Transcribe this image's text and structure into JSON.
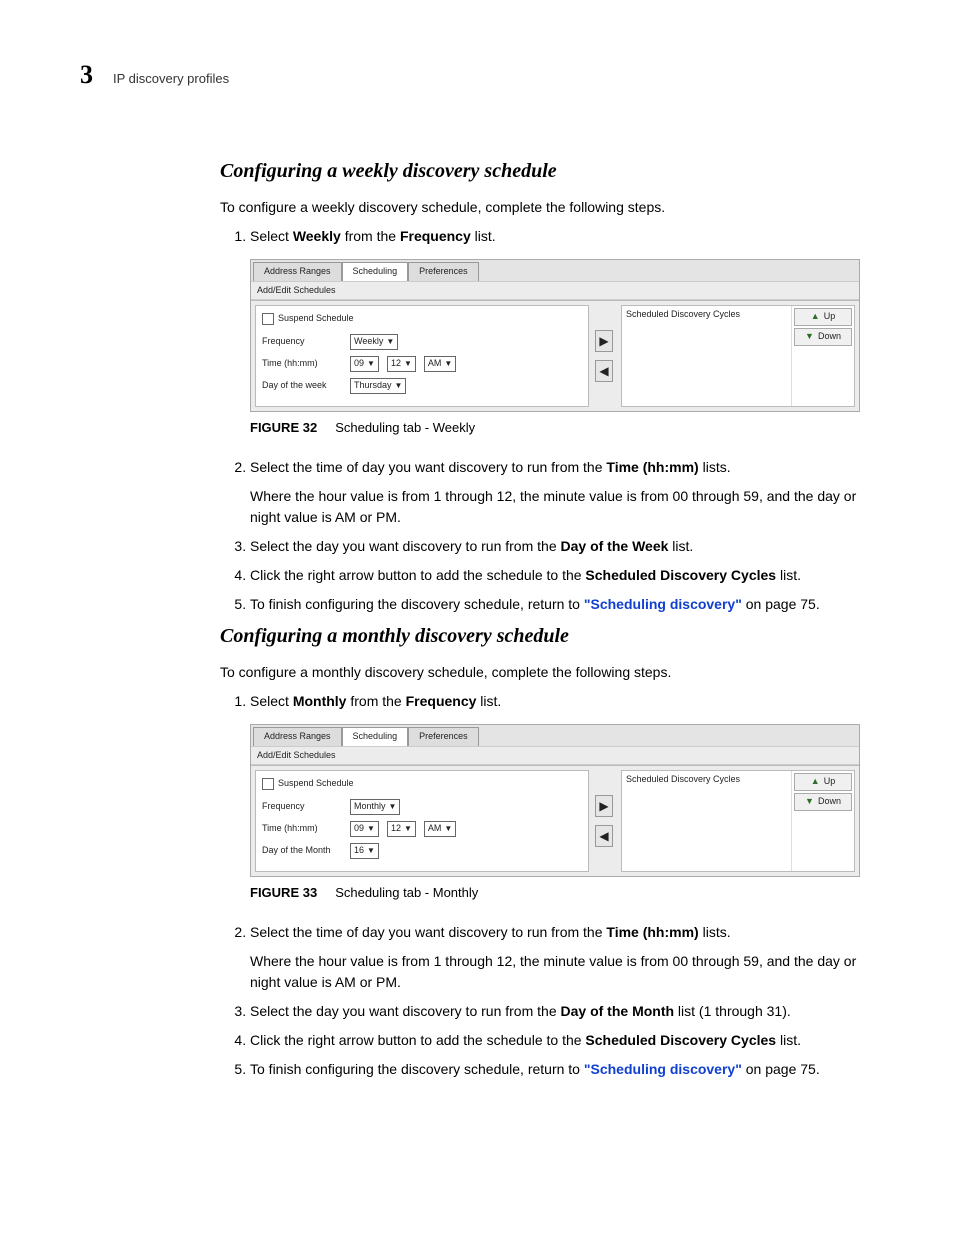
{
  "header": {
    "chapter": "3",
    "section": "IP discovery profiles"
  },
  "h_weekly": "Configuring a weekly discovery schedule",
  "p_weekly_intro": "To configure a weekly discovery schedule, complete the following steps.",
  "weekly": {
    "s1_a": "Select ",
    "s1_b": "Weekly",
    "s1_c": " from the ",
    "s1_d": "Frequency",
    "s1_e": " list.",
    "s2_a": "Select the time of day you want discovery to run from the ",
    "s2_b": "Time (hh:mm)",
    "s2_c": " lists.",
    "s2_sub": "Where the hour value is from 1 through 12, the minute value is from 00 through 59, and the day or night value is AM or PM.",
    "s3_a": "Select the day you want discovery to run from the ",
    "s3_b": "Day of the Week",
    "s3_c": " list.",
    "s4_a": "Click the right arrow button to add the schedule to the ",
    "s4_b": "Scheduled Discovery Cycles",
    "s4_c": " list.",
    "s5_a": "To finish configuring the discovery schedule, return to ",
    "s5_link": "\"Scheduling discovery\"",
    "s5_b": " on page 75."
  },
  "fig32": {
    "label": "FIGURE 32",
    "caption": "Scheduling tab - Weekly"
  },
  "panel": {
    "tabs": [
      "Address Ranges",
      "Scheduling",
      "Preferences"
    ],
    "active_tab": 1,
    "left_title": "Add/Edit Schedules",
    "right_title": "Scheduled Discovery Cycles",
    "suspend": "Suspend Schedule",
    "lbl_freq": "Frequency",
    "lbl_time": "Time (hh:mm)",
    "lbl_dow": "Day of the week",
    "lbl_dom": "Day of the Month",
    "up": "Up",
    "down": "Down",
    "weekly_freq": "Weekly",
    "hh": "09",
    "mm": "12",
    "ampm": "AM",
    "dow_val": "Thursday",
    "monthly_freq": "Monthly",
    "dom_val": "16"
  },
  "h_monthly": "Configuring a monthly discovery schedule",
  "p_monthly_intro": "To configure a monthly discovery schedule, complete the following steps.",
  "monthly": {
    "s1_a": "Select ",
    "s1_b": "Monthly",
    "s1_c": " from the ",
    "s1_d": "Frequency",
    "s1_e": " list.",
    "s2_a": "Select the time of day you want discovery to run from the ",
    "s2_b": "Time (hh:mm)",
    "s2_c": " lists.",
    "s2_sub": "Where the hour value is from 1 through 12, the minute value is from 00 through 59, and the day or night value is AM or PM.",
    "s3_a": "Select the day you want discovery to run from the ",
    "s3_b": "Day of the Month",
    "s3_c": " list (1 through 31).",
    "s4_a": "Click the right arrow button to add the schedule to the ",
    "s4_b": "Scheduled Discovery Cycles",
    "s4_c": " list.",
    "s5_a": "To finish configuring the discovery schedule, return to ",
    "s5_link": "\"Scheduling discovery\"",
    "s5_b": " on page 75."
  },
  "fig33": {
    "label": "FIGURE 33",
    "caption": "Scheduling tab - Monthly"
  }
}
